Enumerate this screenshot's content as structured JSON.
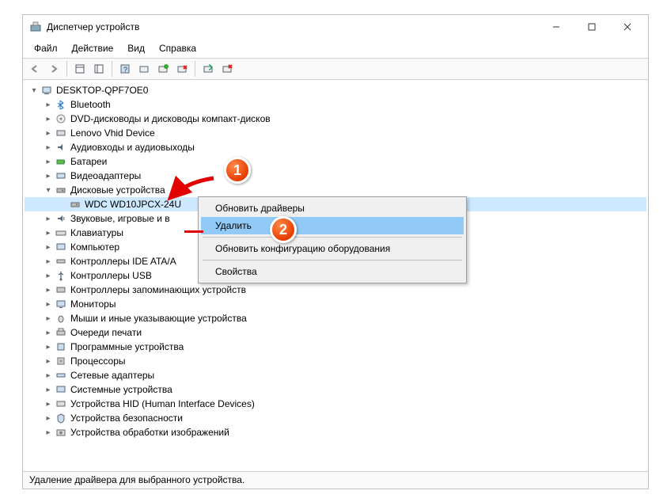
{
  "window": {
    "title": "Диспетчер устройств"
  },
  "menubar": {
    "file": "Файл",
    "action": "Действие",
    "view": "Вид",
    "help": "Справка"
  },
  "tree": {
    "root": "DESKTOP-QPF7OE0",
    "bluetooth": "Bluetooth",
    "dvd": "DVD-дисководы и дисководы компакт-дисков",
    "lenovo": "Lenovo Vhid Device",
    "audio": "Аудиовходы и аудиовыходы",
    "battery": "Батареи",
    "video": "Видеоадаптеры",
    "disks": "Дисковые устройства",
    "disk_device": "WDC WD10JPCX-24U",
    "sound": "Звуковые, игровые и в",
    "keyboard": "Клавиатуры",
    "computer": "Компьютер",
    "ide": "Контроллеры IDE ATA/A",
    "usb": "Контроллеры USB",
    "storage": "Контроллеры запоминающих устройств",
    "monitor": "Мониторы",
    "mouse": "Мыши и иные указывающие устройства",
    "print": "Очереди печати",
    "software": "Программные устройства",
    "cpu": "Процессоры",
    "network": "Сетевые адаптеры",
    "system": "Системные устройства",
    "hid": "Устройства HID (Human Interface Devices)",
    "security": "Устройства безопасности",
    "imaging": "Устройства обработки изображений"
  },
  "context_menu": {
    "update_drivers": "Обновить драйверы",
    "delete": "Удалить",
    "scan_hw": "Обновить конфигурацию оборудования",
    "properties": "Свойства"
  },
  "statusbar": {
    "text": "Удаление драйвера для выбранного устройства."
  },
  "callouts": {
    "one": "1",
    "two": "2"
  }
}
